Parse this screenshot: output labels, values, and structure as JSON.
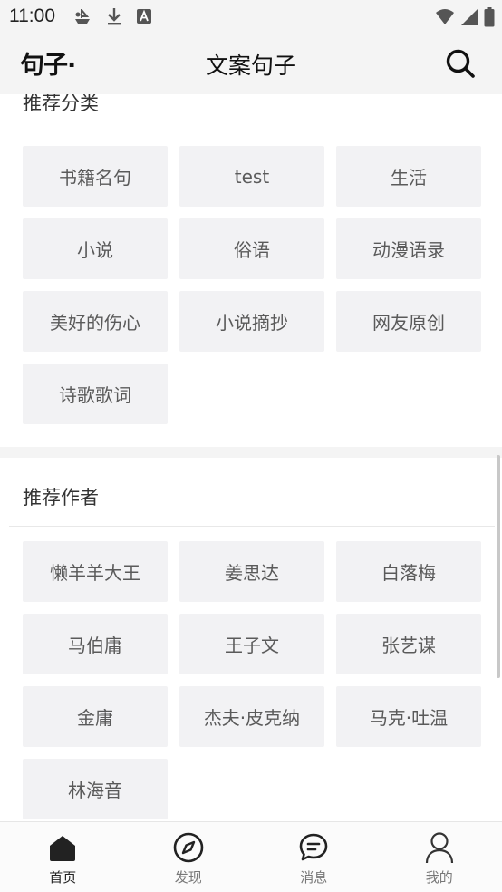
{
  "status_bar": {
    "time": "11:00"
  },
  "app_bar": {
    "logo": "句子·",
    "title": "文案句子"
  },
  "categories": {
    "title": "推荐分类",
    "items": [
      "书籍名句",
      "test",
      "生活",
      "小说",
      "俗语",
      "动漫语录",
      "美好的伤心",
      "小说摘抄",
      "网友原创",
      "诗歌歌词"
    ]
  },
  "authors": {
    "title": "推荐作者",
    "items": [
      "懒羊羊大王",
      "姜思达",
      "白落梅",
      "马伯庸",
      "王子文",
      "张艺谋",
      "金庸",
      "杰夫·皮克纳",
      "马克·吐温",
      "林海音"
    ]
  },
  "bottom_nav": {
    "items": [
      {
        "label": "首页",
        "icon": "home-icon",
        "active": true
      },
      {
        "label": "发现",
        "icon": "compass-icon",
        "active": false
      },
      {
        "label": "消息",
        "icon": "message-icon",
        "active": false
      },
      {
        "label": "我的",
        "icon": "user-icon",
        "active": false
      }
    ]
  },
  "colors": {
    "tag_bg": "#f2f2f4",
    "bar_bg": "#f4f4f4",
    "text": "#222222"
  }
}
